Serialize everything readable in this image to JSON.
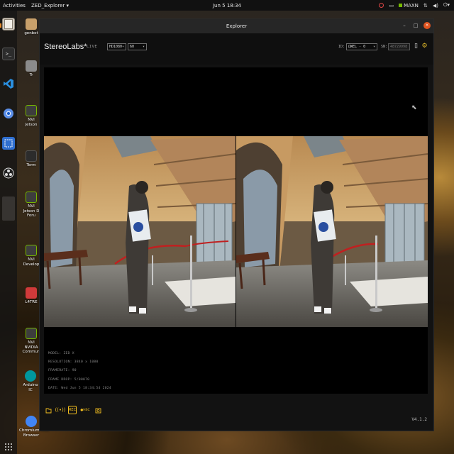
{
  "topbar": {
    "activities": "Activities",
    "app_menu": "ZED_Explorer ▾",
    "clock": "Jun 5 18:34",
    "maxn": "MAXN"
  },
  "desktop_icons": [
    {
      "label": "genbot"
    },
    {
      "label": "Tr"
    },
    {
      "label": "NVI\nJetson"
    },
    {
      "label": "Term"
    },
    {
      "label": "NVI\nJetson D\nForu"
    },
    {
      "label": "NVI\nDevelop"
    },
    {
      "label": "L4TRE"
    },
    {
      "label": "NVI\nNVIDIA\nCommun"
    },
    {
      "label": "Arduino IC"
    },
    {
      "label": "Chromium Web\nBrowser"
    }
  ],
  "window": {
    "title": "Explorer",
    "controls": {
      "minimize": "–",
      "maximize": "□",
      "close": "×"
    }
  },
  "header": {
    "brand": "StereoLabs*",
    "status": "LIVE",
    "resolution_select": "HD1080",
    "fps_select": "60",
    "id_label": "ID:",
    "id_select": "ΩWEL - 0",
    "sn_label": "SN:",
    "sn_value": "48729998"
  },
  "overlay": {
    "model": "MODEL: ZED X",
    "resolution": "RESOLUTION: 3840 x 1080",
    "framerate": "FRAMERATE: 90",
    "frame_drop": "FRAME DROP: 5/00070",
    "date": "DATE: Wed Jun 5 18:34:54 2024"
  },
  "toolbar": {
    "rec_label": "REC",
    "mode_label": "●HSC"
  },
  "footer": {
    "version": "V4.1.2"
  },
  "icons": {
    "close": "close-icon",
    "camera": "camera-icon",
    "settings": "gear-icon",
    "folder": "folder-icon",
    "broadcast": "broadcast-icon",
    "record": "record-icon",
    "snapshot": "snapshot-icon",
    "cursor": "cursor-icon"
  },
  "colors": {
    "accent": "#f4c020",
    "close_button": "#e0541f",
    "window_bg": "#121212"
  }
}
